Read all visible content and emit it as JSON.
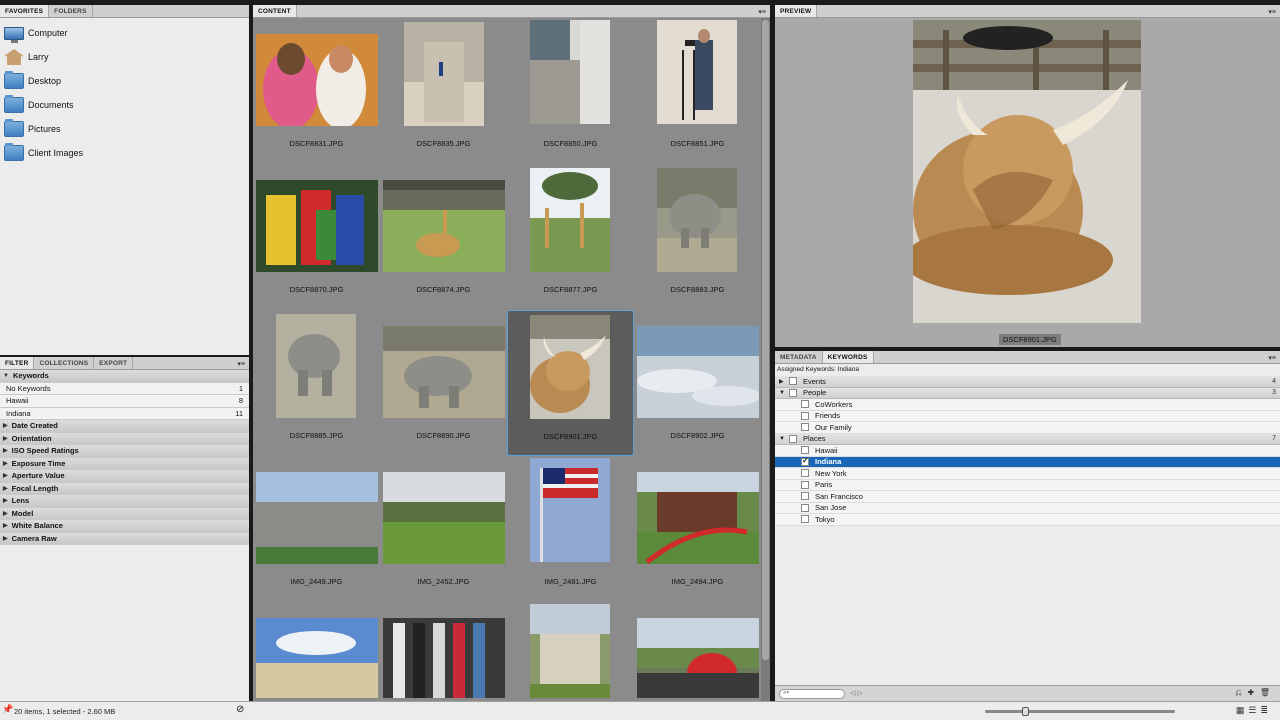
{
  "favorites_panel": {
    "tabs": [
      "FAVORITES",
      "FOLDERS"
    ],
    "items": [
      {
        "label": "Computer",
        "icon": "computer-icon"
      },
      {
        "label": "Larry",
        "icon": "home-icon"
      },
      {
        "label": "Desktop",
        "icon": "folder-icon"
      },
      {
        "label": "Documents",
        "icon": "folder-icon"
      },
      {
        "label": "Pictures",
        "icon": "folder-icon"
      },
      {
        "label": "Client Images",
        "icon": "folder-icon"
      }
    ]
  },
  "filter_panel": {
    "tabs": [
      "FILTER",
      "COLLECTIONS",
      "EXPORT"
    ],
    "keywords_header": "Keywords",
    "keyword_items": [
      {
        "label": "No Keywords",
        "count": "1"
      },
      {
        "label": "Hawaii",
        "count": "8"
      },
      {
        "label": "Indiana",
        "count": "11"
      }
    ],
    "categories": [
      "Date Created",
      "Orientation",
      "ISO Speed Ratings",
      "Exposure Time",
      "Aperture Value",
      "Focal Length",
      "Lens",
      "Model",
      "White Balance",
      "Camera Raw"
    ]
  },
  "content_panel": {
    "tab": "CONTENT",
    "thumbnails": [
      {
        "name": "DSCF8831.JPG"
      },
      {
        "name": "DSCF8835.JPG"
      },
      {
        "name": "DSCF8850.JPG"
      },
      {
        "name": "DSCF8851.JPG"
      },
      {
        "name": "DSCF8870.JPG"
      },
      {
        "name": "DSCF8874.JPG"
      },
      {
        "name": "DSCF8877.JPG"
      },
      {
        "name": "DSCF8883.JPG"
      },
      {
        "name": "DSCF8885.JPG"
      },
      {
        "name": "DSCF8890.JPG"
      },
      {
        "name": "DSCF8901.JPG",
        "selected": true
      },
      {
        "name": "DSCF8902.JPG"
      },
      {
        "name": "IMG_2449.JPG"
      },
      {
        "name": "IMG_2452.JPG"
      },
      {
        "name": "IMG_2481.JPG"
      },
      {
        "name": "IMG_2494.JPG"
      },
      {
        "name": ""
      },
      {
        "name": ""
      },
      {
        "name": ""
      },
      {
        "name": ""
      }
    ]
  },
  "preview_panel": {
    "tab": "PREVIEW",
    "caption": "DSCF8901.JPG"
  },
  "keywords_panel": {
    "tabs": [
      "METADATA",
      "KEYWORDS"
    ],
    "assigned": "Assigned Keywords: Indiana",
    "groups": [
      {
        "label": "Events",
        "count": "4",
        "expanded": false,
        "children": []
      },
      {
        "label": "People",
        "count": "3",
        "expanded": true,
        "children": [
          {
            "label": "CoWorkers",
            "checked": false
          },
          {
            "label": "Friends",
            "checked": false
          },
          {
            "label": "Our Family",
            "checked": false
          }
        ]
      },
      {
        "label": "Places",
        "count": "7",
        "expanded": true,
        "children": [
          {
            "label": "Hawaii",
            "checked": false
          },
          {
            "label": "Indiana",
            "checked": true,
            "selected": true
          },
          {
            "label": "New York",
            "checked": false
          },
          {
            "label": "Paris",
            "checked": false
          },
          {
            "label": "San Francisco",
            "checked": false
          },
          {
            "label": "San Jose",
            "checked": false
          },
          {
            "label": "Tokyo",
            "checked": false
          }
        ]
      }
    ],
    "search_placeholder": "⌕▾"
  },
  "status_bar": {
    "text": "20 items, 1 selected - 2.60 MB"
  }
}
